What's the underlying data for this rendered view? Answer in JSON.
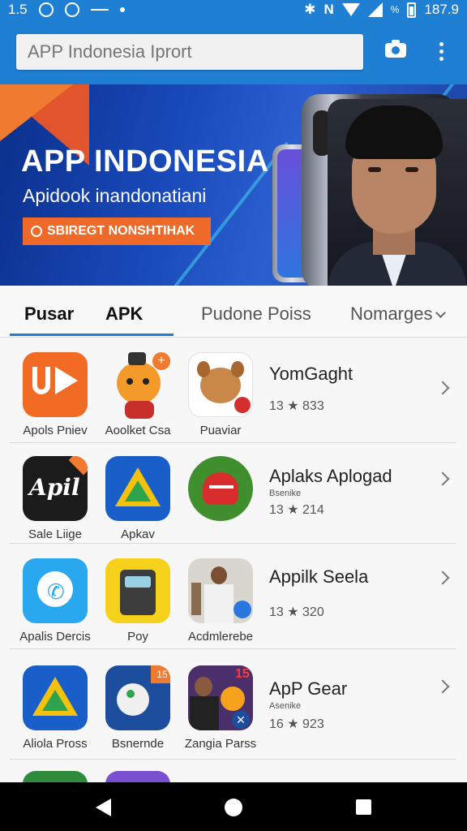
{
  "status_bar": {
    "left_number": "1.5",
    "time": "187.9",
    "percent": "%"
  },
  "search": {
    "placeholder": "APP Indonesia Iprort"
  },
  "banner": {
    "title": "APP INDONESIA",
    "subtitle": "Apidook inandonatiani",
    "button_label": "SBIREGT NONSHTIHAK"
  },
  "tabs": [
    {
      "label": "Pusar",
      "active": true
    },
    {
      "label": "APK",
      "active": true
    },
    {
      "label": "Pudone Poiss",
      "active": false
    },
    {
      "label": "Nomarges",
      "active": false
    }
  ],
  "rows": [
    {
      "apps": [
        {
          "label": "Apols Pniev",
          "icon": "up-play-icon"
        },
        {
          "label": "Aoolket Csa",
          "icon": "cartoon-fox-icon"
        },
        {
          "label": "Puaviar",
          "icon": "cartoon-dog-icon"
        }
      ],
      "title": "YomGaght",
      "subtitle": "",
      "meta": "13 ★ 833"
    },
    {
      "apps": [
        {
          "label": "Sale Liige",
          "icon": "script-logo-icon"
        },
        {
          "label": "Apkav",
          "icon": "drive-triangle-icon"
        },
        {
          "label": "",
          "icon": "heart-key-icon"
        }
      ],
      "title": "Aplaks Aplogad",
      "subtitle": "Bsenike",
      "meta": "13 ★ 214"
    },
    {
      "apps": [
        {
          "label": "Apalis Dercis",
          "icon": "phone-call-icon"
        },
        {
          "label": "Poy",
          "icon": "robot-face-icon"
        },
        {
          "label": "Acdmlerebe",
          "icon": "people-photo-icon"
        }
      ],
      "title": "Appilk Seela",
      "subtitle": "",
      "meta": "13 ★ 320"
    },
    {
      "apps": [
        {
          "label": "Aliola Pross",
          "icon": "drive-triangle-icon"
        },
        {
          "label": "Bsnernde",
          "icon": "paint-brush-icon"
        },
        {
          "label": "Zangia Parss",
          "icon": "man-fireworks-icon"
        }
      ],
      "title": "ApP Gear",
      "subtitle": "Asenike",
      "meta": "16 ★ 923"
    }
  ],
  "badges": {
    "row4_icon2": "15",
    "row4_icon3": "15"
  },
  "colors": {
    "accent": "#1f7fd3",
    "orange": "#ef6a28",
    "nav": "#000000"
  }
}
